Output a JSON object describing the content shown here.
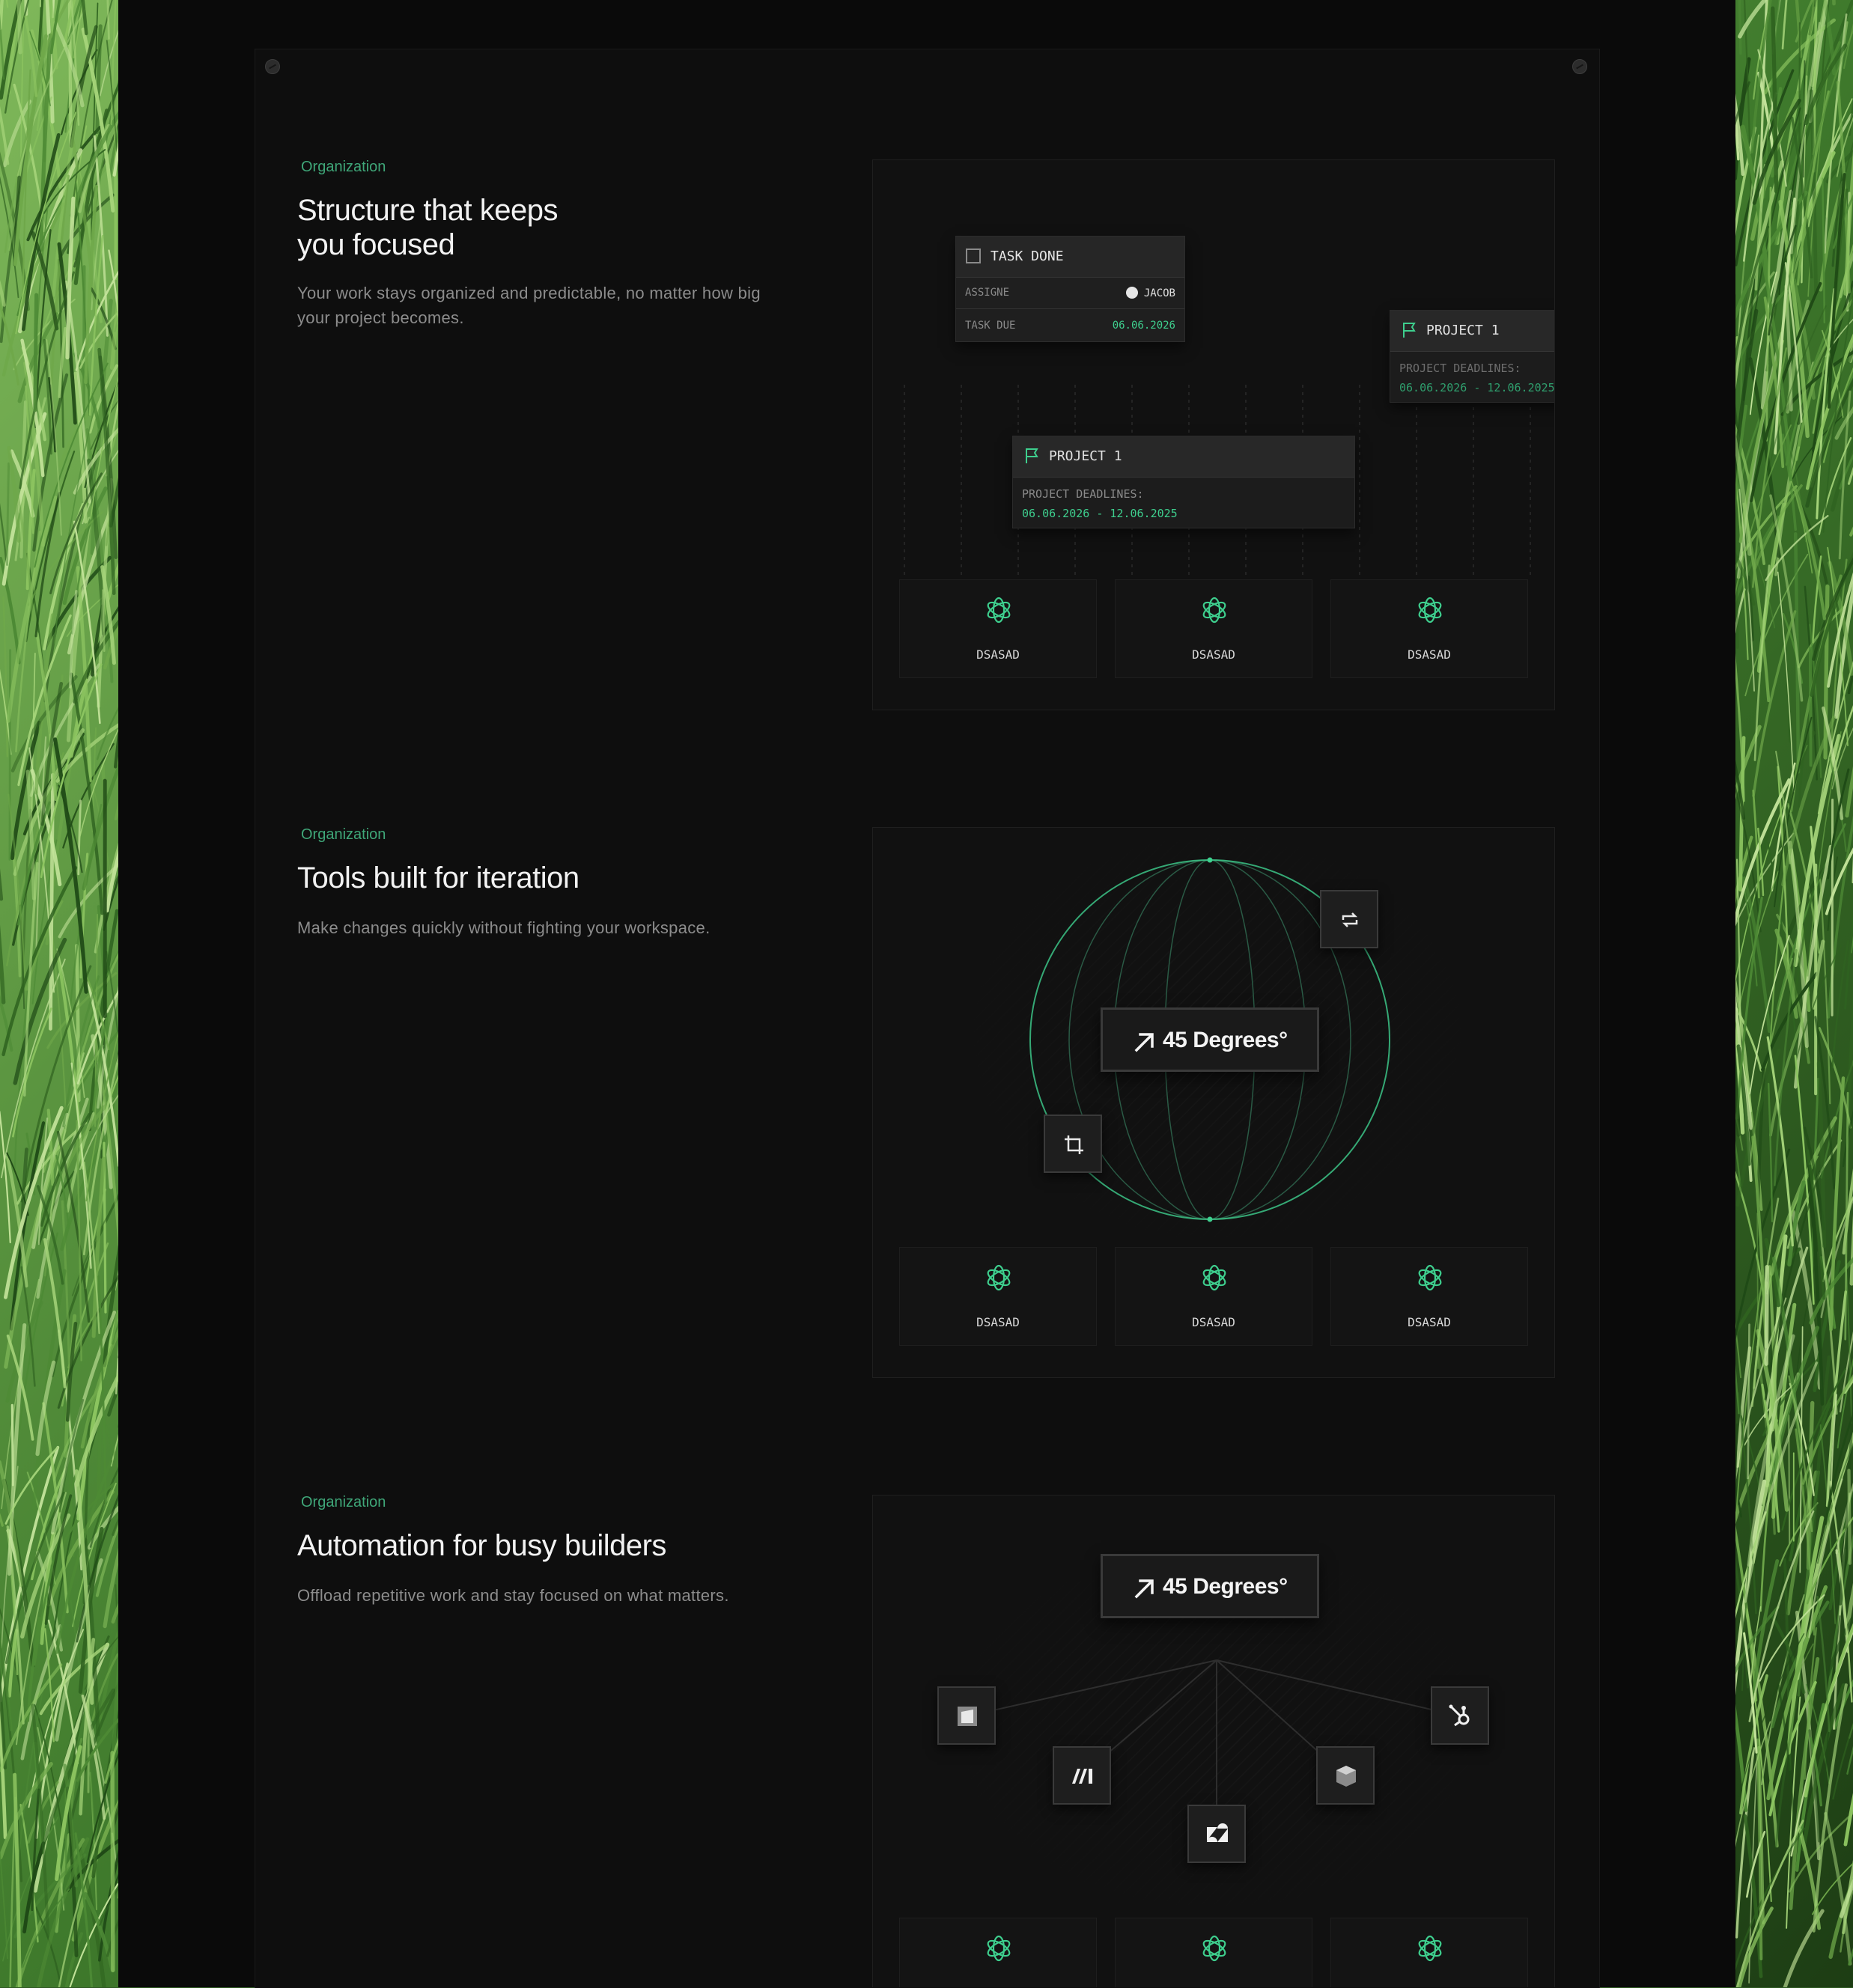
{
  "sections": [
    {
      "eyebrow": "Organization",
      "title_lines": [
        "Structure that keeps",
        "you focused"
      ],
      "description_lines": [
        "Your work stays organized and predictable, no matter how big",
        "your project becomes."
      ],
      "task_card": {
        "title": "TASK DONE",
        "assignee_label": "ASSIGNE",
        "assignee_value": "JACOB",
        "due_label": "TASK DUE",
        "due_value": "06.06.2026"
      },
      "project_cards": [
        {
          "title": "PROJECT 1",
          "deadline_label": "PROJECT DEADLINES:",
          "deadline_value": "06.06.2026 - 12.06.2025"
        },
        {
          "title": "PROJECT 1",
          "deadline_label": "PROJECT DEADLINES:",
          "deadline_value": "06.06.2026 - 12.06.2025"
        }
      ],
      "tiles": [
        "DSASAD",
        "DSASAD",
        "DSASAD"
      ]
    },
    {
      "eyebrow": "Organization",
      "title_lines": [
        "Tools built for iteration"
      ],
      "description_lines": [
        "Make changes quickly without fighting your workspace."
      ],
      "badge": "45 Degrees°",
      "icons": [
        "repeat-icon",
        "crop-icon"
      ],
      "tiles": [
        "DSASAD",
        "DSASAD",
        "DSASAD"
      ]
    },
    {
      "eyebrow": "Organization",
      "title_lines": [
        "Automation for busy builders"
      ],
      "description_lines": [
        "Offload repetitive work and stay focused on what matters."
      ],
      "badge": "45 Degrees°",
      "integrations": [
        "square-app-icon",
        "make-icon",
        "zendesk-icon",
        "box-icon",
        "hubspot-icon"
      ],
      "tiles": [
        "",
        "",
        ""
      ]
    }
  ],
  "colors": {
    "accent": "#3ecf8e",
    "eyebrow": "#3fa678",
    "background": "#0e0e0e"
  }
}
